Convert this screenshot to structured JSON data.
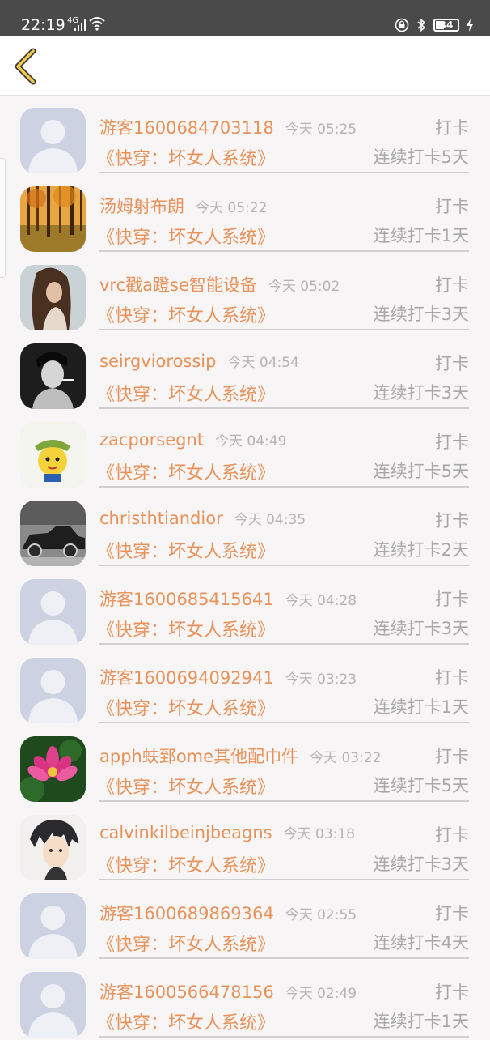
{
  "status_bar": {
    "time": "22:19",
    "network": "4G",
    "battery": "34"
  },
  "header": {
    "back_icon": "chevron-left-icon"
  },
  "list": [
    {
      "avatar": "default-user",
      "name": "游客1600684703118",
      "time": "今天 05:25",
      "action": "打卡",
      "book": "《快穿：坏女人系统》",
      "streak": "连续打卡5天"
    },
    {
      "avatar": "autumn-forest",
      "name": "汤姆射布朗",
      "time": "今天 05:22",
      "action": "打卡",
      "book": "《快穿：坏女人系统》",
      "streak": "连续打卡1天"
    },
    {
      "avatar": "woman-hair",
      "name": "vrc戳a蹬se智能设备",
      "time": "今天 05:02",
      "action": "打卡",
      "book": "《快穿：坏女人系统》",
      "streak": "连续打卡3天"
    },
    {
      "avatar": "man-smoking-bw",
      "name": "seirgviorossip",
      "time": "今天 04:54",
      "action": "打卡",
      "book": "《快穿：坏女人系统》",
      "streak": "连续打卡3天"
    },
    {
      "avatar": "cartoon-character",
      "name": "zacporsegnt",
      "time": "今天 04:49",
      "action": "打卡",
      "book": "《快穿：坏女人系统》",
      "streak": "连续打卡5天"
    },
    {
      "avatar": "vintage-car-bw",
      "name": "christhtiandior",
      "time": "今天 04:35",
      "action": "打卡",
      "book": "《快穿：坏女人系统》",
      "streak": "连续打卡2天"
    },
    {
      "avatar": "default-user",
      "name": "游客1600685415641",
      "time": "今天 04:28",
      "action": "打卡",
      "book": "《快穿：坏女人系统》",
      "streak": "连续打卡3天"
    },
    {
      "avatar": "default-user",
      "name": "游客1600694092941",
      "time": "今天 03:23",
      "action": "打卡",
      "book": "《快穿：坏女人系统》",
      "streak": "连续打卡1天"
    },
    {
      "avatar": "lotus-flower",
      "name": "apph蚨郅ome其他配巾件",
      "time": "今天 03:22",
      "action": "打卡",
      "book": "《快穿：坏女人系统》",
      "streak": "连续打卡5天"
    },
    {
      "avatar": "anime-boy",
      "name": "calvinkilbeinjbeagns",
      "time": "今天 03:18",
      "action": "打卡",
      "book": "《快穿：坏女人系统》",
      "streak": "连续打卡3天"
    },
    {
      "avatar": "default-user",
      "name": "游客1600689869364",
      "time": "今天 02:55",
      "action": "打卡",
      "book": "《快穿：坏女人系统》",
      "streak": "连续打卡4天"
    },
    {
      "avatar": "default-user",
      "name": "游客1600566478156",
      "time": "今天 02:49",
      "action": "打卡",
      "book": "《快穿：坏女人系统》",
      "streak": "连续打卡1天"
    }
  ],
  "colors": {
    "accent_orange": "#e8925a",
    "back_arrow_yellow": "#f3c94b",
    "gray_text": "#a8a8a8",
    "status_bar_bg": "#4a4a4a"
  }
}
